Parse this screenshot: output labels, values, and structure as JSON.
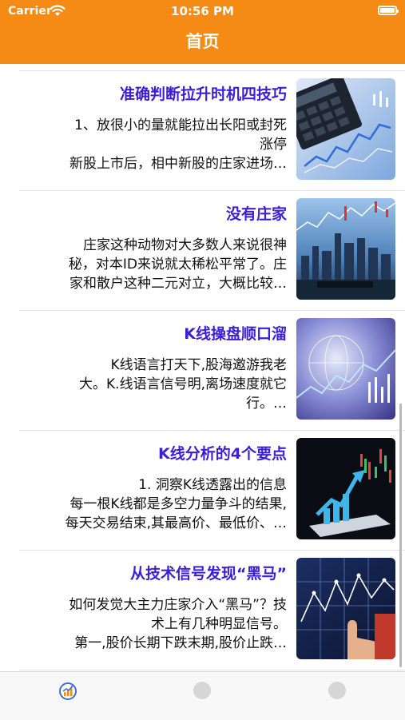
{
  "status_bar": {
    "carrier": "Carrier",
    "time": "10:56 PM"
  },
  "nav": {
    "title": "首页"
  },
  "articles": [
    {
      "title": "准确判断拉升时机四技巧",
      "desc_lines": [
        "1、放很小的量就能拉出长阳或封死",
        "涨停",
        "新股上市后，相中新股的庄家进场…"
      ],
      "thumb_icon": "calculator-stock-chart-image"
    },
    {
      "title": "没有庄家",
      "desc_lines": [
        "庄家这种动物对大多数人来说很神",
        "秘，对本ID来说就太稀松平常了。庄",
        "家和散户这种二元对立，大概比较…"
      ],
      "thumb_icon": "city-skyline-chart-image"
    },
    {
      "title": "K线操盘顺口溜",
      "desc_lines": [
        "K线语言打天下,股海邀游我老",
        "大。K.线语言信号明,离场速度就它",
        "行。…"
      ],
      "thumb_icon": "globe-network-image"
    },
    {
      "title": "K线分析的4个要点",
      "desc_lines": [
        "1.    洞察K线透露出的信息",
        "每一根K线都是多空力量争斗的结果,",
        "每天交易结束,其最高价、最低价、…"
      ],
      "thumb_icon": "tablet-growth-arrow-image"
    },
    {
      "title": "从技术信号发现“黑马”",
      "desc_lines": [
        "如何发觉大主力庄家介入“黑马”？技",
        "术上有几种明显信号。",
        "第一,股价长期下跌末期,股价止跌…"
      ],
      "thumb_icon": "hand-touch-chart-image"
    }
  ],
  "tabbar": {
    "tabs": [
      {
        "icon": "chart-home-icon",
        "active": true
      },
      {
        "icon": "placeholder-circle-icon",
        "active": false
      },
      {
        "icon": "placeholder-circle-icon",
        "active": false
      }
    ]
  },
  "colors": {
    "accent": "#f58a14",
    "title": "#3a1fd6"
  }
}
